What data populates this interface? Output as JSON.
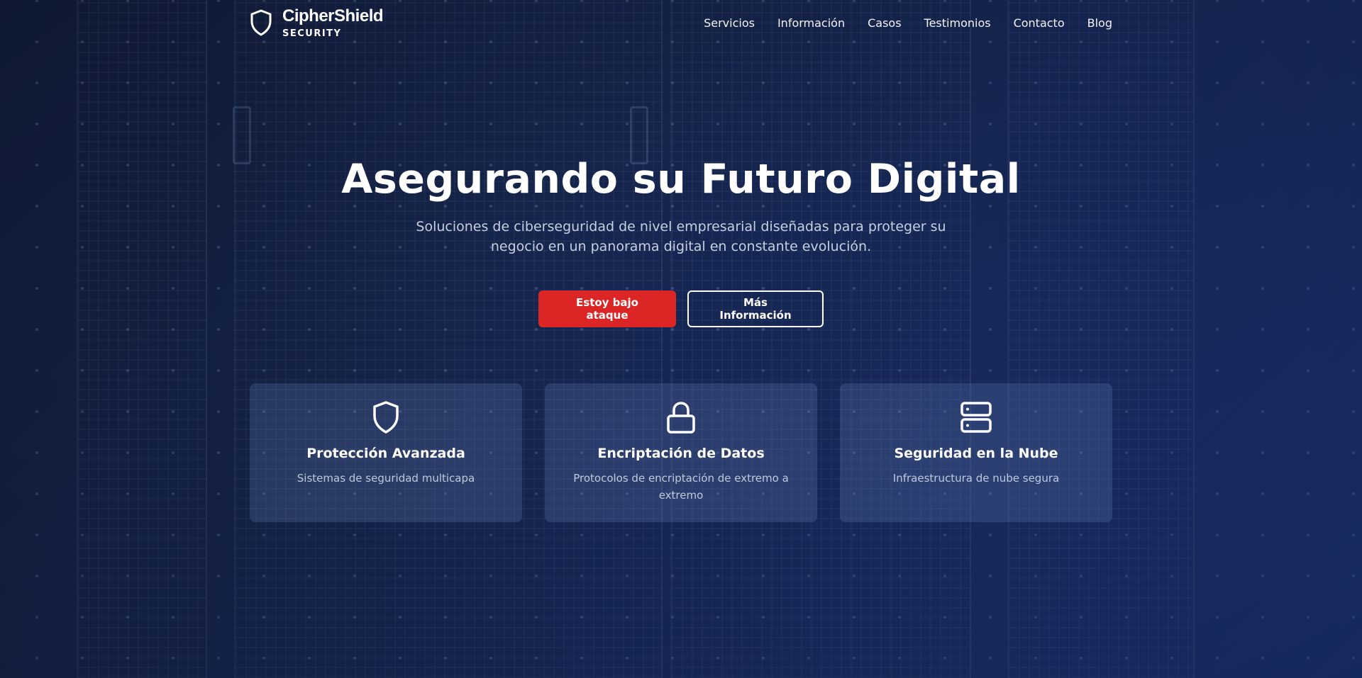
{
  "brand": {
    "name": "CipherShield",
    "sub": "SECURITY"
  },
  "nav": {
    "items": [
      "Servicios",
      "Información",
      "Casos",
      "Testimonios",
      "Contacto",
      "Blog"
    ]
  },
  "hero": {
    "title": "Asegurando su Futuro Digital",
    "subtitle": "Soluciones de ciberseguridad de nivel empresarial diseñadas para proteger su negocio en un panorama digital en constante evolución.",
    "primary_button": "Estoy bajo ataque",
    "secondary_button": "Más Información"
  },
  "features": [
    {
      "icon": "shield-icon",
      "title": "Protección Avanzada",
      "description": "Sistemas de seguridad multicapa"
    },
    {
      "icon": "lock-icon",
      "title": "Encriptación de Datos",
      "description": "Protocolos de encriptación de extremo a extremo"
    },
    {
      "icon": "server-icon",
      "title": "Seguridad en la Nube",
      "description": "Infraestructura de nube segura"
    }
  ],
  "colors": {
    "accent": "#dc2626",
    "background_start": "#0f1a33",
    "background_end": "#1f3a86"
  }
}
